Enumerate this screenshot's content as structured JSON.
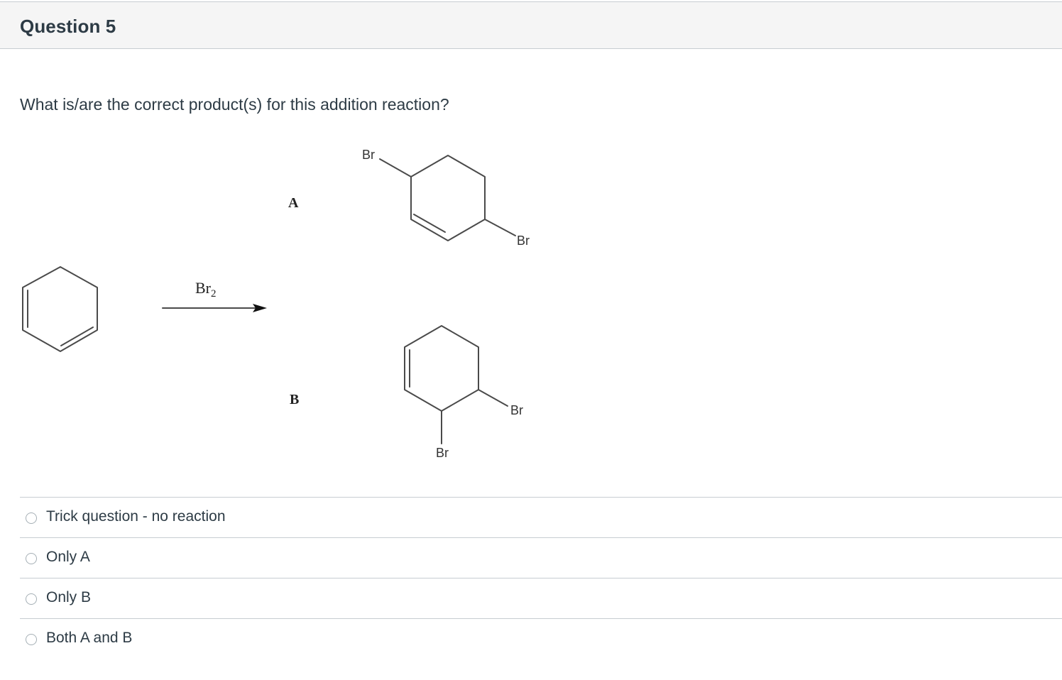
{
  "question": {
    "title": "Question 5",
    "prompt": "What is/are the correct product(s) for this addition reaction?"
  },
  "figure": {
    "reagent": "Br",
    "reagent_subscript": "2",
    "product_a_label": "A",
    "product_b_label": "B",
    "substituent": "Br"
  },
  "answers": [
    {
      "label": "Trick question - no reaction",
      "selected": false
    },
    {
      "label": "Only A",
      "selected": false
    },
    {
      "label": "Only B",
      "selected": false
    },
    {
      "label": "Both A and B",
      "selected": false
    }
  ]
}
